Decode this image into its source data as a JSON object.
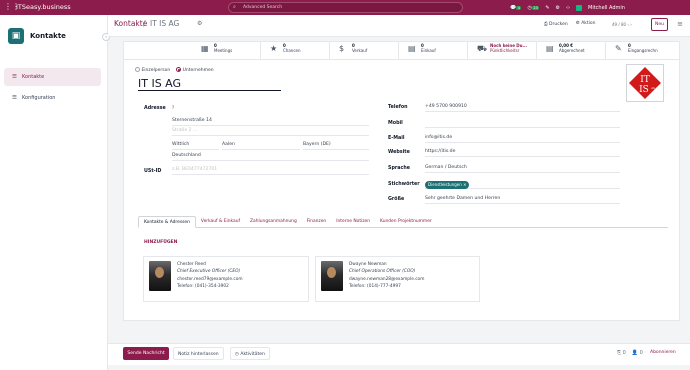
{
  "topbar": {
    "brand": "ITSeasy.business",
    "search_placeholder": "Advanced Search",
    "user": "Mitchell Admin",
    "msg_count": "4",
    "activity_count": "23"
  },
  "sidebar": {
    "app_title": "Kontakte",
    "items": [
      {
        "label": "Kontakte",
        "active": true
      },
      {
        "label": "Konfiguration",
        "active": false
      }
    ]
  },
  "header": {
    "breadcrumb_parent": "Kontakte",
    "breadcrumb_current": "IT IS AG",
    "print": "Drucken",
    "action": "Aktion",
    "pager": "49 / 80",
    "new": "Neu"
  },
  "smart_buttons": [
    {
      "icon": "calendar-icon",
      "glyph": "▦",
      "value": "0",
      "label": "Meetings"
    },
    {
      "icon": "star-icon",
      "glyph": "★",
      "value": "0",
      "label": "Chancen"
    },
    {
      "icon": "dollar-icon",
      "glyph": "$",
      "value": "0",
      "label": "Verkauf"
    },
    {
      "icon": "invoice-icon",
      "glyph": "▤",
      "value": "0",
      "label": "Einkauf"
    },
    {
      "icon": "truck-icon",
      "glyph": "⛟",
      "value": "Noch keine Du...",
      "label": "Pünktlichkeitsr"
    },
    {
      "icon": "invoice-icon",
      "glyph": "▤",
      "value": "0,00 €",
      "label": "Abgerechnet"
    },
    {
      "icon": "edit-icon",
      "glyph": "✎",
      "value": "0",
      "label": "Eingangsrechn"
    }
  ],
  "company_type": {
    "individual": "Einzelperson",
    "company": "Unternehmen"
  },
  "partner": {
    "name": "IT IS AG"
  },
  "address": {
    "label": "Adresse",
    "street": "Sternenstraße 14",
    "street2_ph": "Straße 2 ...",
    "city": "Wittlich",
    "city2": "Aalen",
    "state": "Bayern (DE)",
    "country": "Deutschland",
    "vat_label": "USt-ID",
    "vat_ph": "z.B. BE0477472701"
  },
  "right_fields": [
    {
      "label": "Telefon",
      "value": "+49 5700 900910",
      "placeholder": false
    },
    {
      "label": "Mobil",
      "value": "",
      "placeholder": false
    },
    {
      "label": "E-Mail",
      "value": "info@itis.de",
      "placeholder": false
    },
    {
      "label": "Website",
      "value": "https://itis.de",
      "placeholder": false
    },
    {
      "label": "Sprache",
      "value": "German / Deutsch",
      "placeholder": false
    },
    {
      "label": "Stichwörter",
      "value": "",
      "placeholder": false
    },
    {
      "label": "Größe",
      "value": "Sehr geehrte Damen und Herren",
      "placeholder": false
    }
  ],
  "tag": "Dienstleistungen",
  "logo_text": {
    "top": "IT",
    "bottom": "IS",
    "mark": "AG"
  },
  "tabs": [
    "Kontakte & Adressen",
    "Verkauf & Einkauf",
    "Zahlungsanmahnung",
    "Finanzen",
    "Interne Notizen",
    "Kunden Projektnummer"
  ],
  "add_label": "HINZUFÜGEN",
  "contacts": [
    {
      "name": "Chester Reed",
      "title": "Chief Executive Officer (CEO)",
      "email": "chester.reed79@example.com",
      "phone": "Telefon: (041)-354-3902"
    },
    {
      "name": "Dwayne Newman",
      "title": "Chief Operations Officer (COO)",
      "email": "dwayne.newman28@example.com",
      "phone": "Telefon: (014)-777-4997"
    }
  ],
  "chatter": {
    "send": "Sende Nachricht",
    "log": "Notiz hinterlassen",
    "activities": "Aktivitäten",
    "follow": "Abonnieren",
    "attach_count": "0",
    "follower_count": "0"
  }
}
